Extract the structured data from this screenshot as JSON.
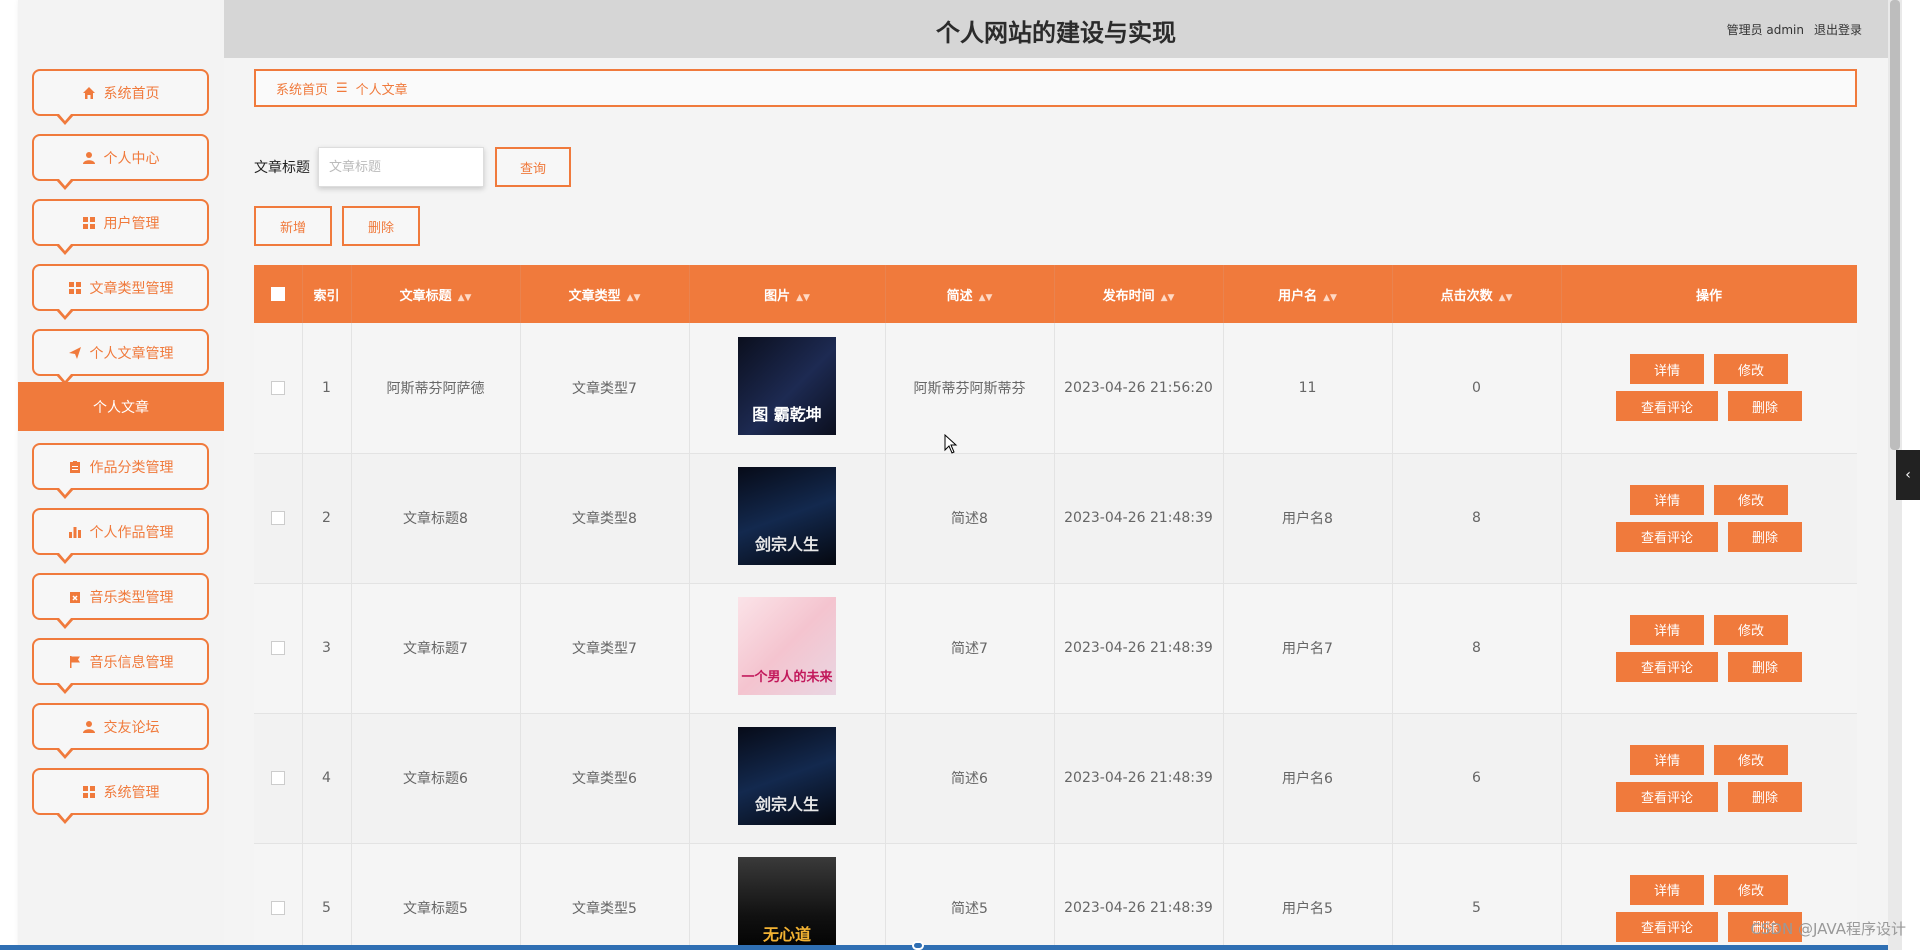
{
  "header": {
    "title": "个人网站的建设与实现",
    "user": "管理员 admin",
    "logout": "退出登录"
  },
  "sidebar": {
    "items": [
      {
        "label": "系统首页",
        "icon": "home-icon"
      },
      {
        "label": "个人中心",
        "icon": "user-icon"
      },
      {
        "label": "用户管理",
        "icon": "grid-icon"
      },
      {
        "label": "文章类型管理",
        "icon": "grid-icon"
      },
      {
        "label": "个人文章管理",
        "icon": "send-icon"
      },
      {
        "label": "作品分类管理",
        "icon": "clipboard-icon"
      },
      {
        "label": "个人作品管理",
        "icon": "bar-chart-icon"
      },
      {
        "label": "音乐类型管理",
        "icon": "clipboard-x-icon"
      },
      {
        "label": "音乐信息管理",
        "icon": "flag-icon"
      },
      {
        "label": "交友论坛",
        "icon": "user-icon"
      },
      {
        "label": "系统管理",
        "icon": "grid-icon"
      }
    ],
    "active_sub": "个人文章"
  },
  "breadcrumb": {
    "home": "系统首页",
    "sep": "☰",
    "current": "个人文章"
  },
  "search": {
    "label": "文章标题",
    "placeholder": "文章标题",
    "value": "",
    "button": "查询"
  },
  "actions": {
    "add": "新增",
    "delete": "删除"
  },
  "table": {
    "columns": [
      "索引",
      "文章标题",
      "文章类型",
      "图片",
      "简述",
      "发布时间",
      "用户名",
      "点击次数",
      "操作"
    ],
    "rows": [
      {
        "index": "1",
        "title": "阿斯蒂芬阿萨德",
        "type": "文章类型7",
        "image_text": "图 霸乾坤",
        "summary": "阿斯蒂芬阿斯蒂芬",
        "time": "2023-04-26 21:56:20",
        "user": "11",
        "clicks": "0"
      },
      {
        "index": "2",
        "title": "文章标题8",
        "type": "文章类型8",
        "image_text": "剑宗人生",
        "summary": "简述8",
        "time": "2023-04-26 21:48:39",
        "user": "用户名8",
        "clicks": "8"
      },
      {
        "index": "3",
        "title": "文章标题7",
        "type": "文章类型7",
        "image_text": "一个男人的未来",
        "summary": "简述7",
        "time": "2023-04-26 21:48:39",
        "user": "用户名7",
        "clicks": "8"
      },
      {
        "index": "4",
        "title": "文章标题6",
        "type": "文章类型6",
        "image_text": "剑宗人生",
        "summary": "简述6",
        "time": "2023-04-26 21:48:39",
        "user": "用户名6",
        "clicks": "6"
      },
      {
        "index": "5",
        "title": "文章标题5",
        "type": "文章类型5",
        "image_text": "无心道",
        "summary": "简述5",
        "time": "2023-04-26 21:48:39",
        "user": "用户名5",
        "clicks": "5"
      }
    ],
    "ops": {
      "detail": "详情",
      "edit": "修改",
      "comments": "查看评论",
      "delete": "删除"
    }
  },
  "misc": {
    "watermark": "CSDN @JAVA程序设计",
    "side_tab": "‹"
  },
  "colors": {
    "accent": "#f07a3c",
    "header_bg": "#d6d6d6"
  }
}
